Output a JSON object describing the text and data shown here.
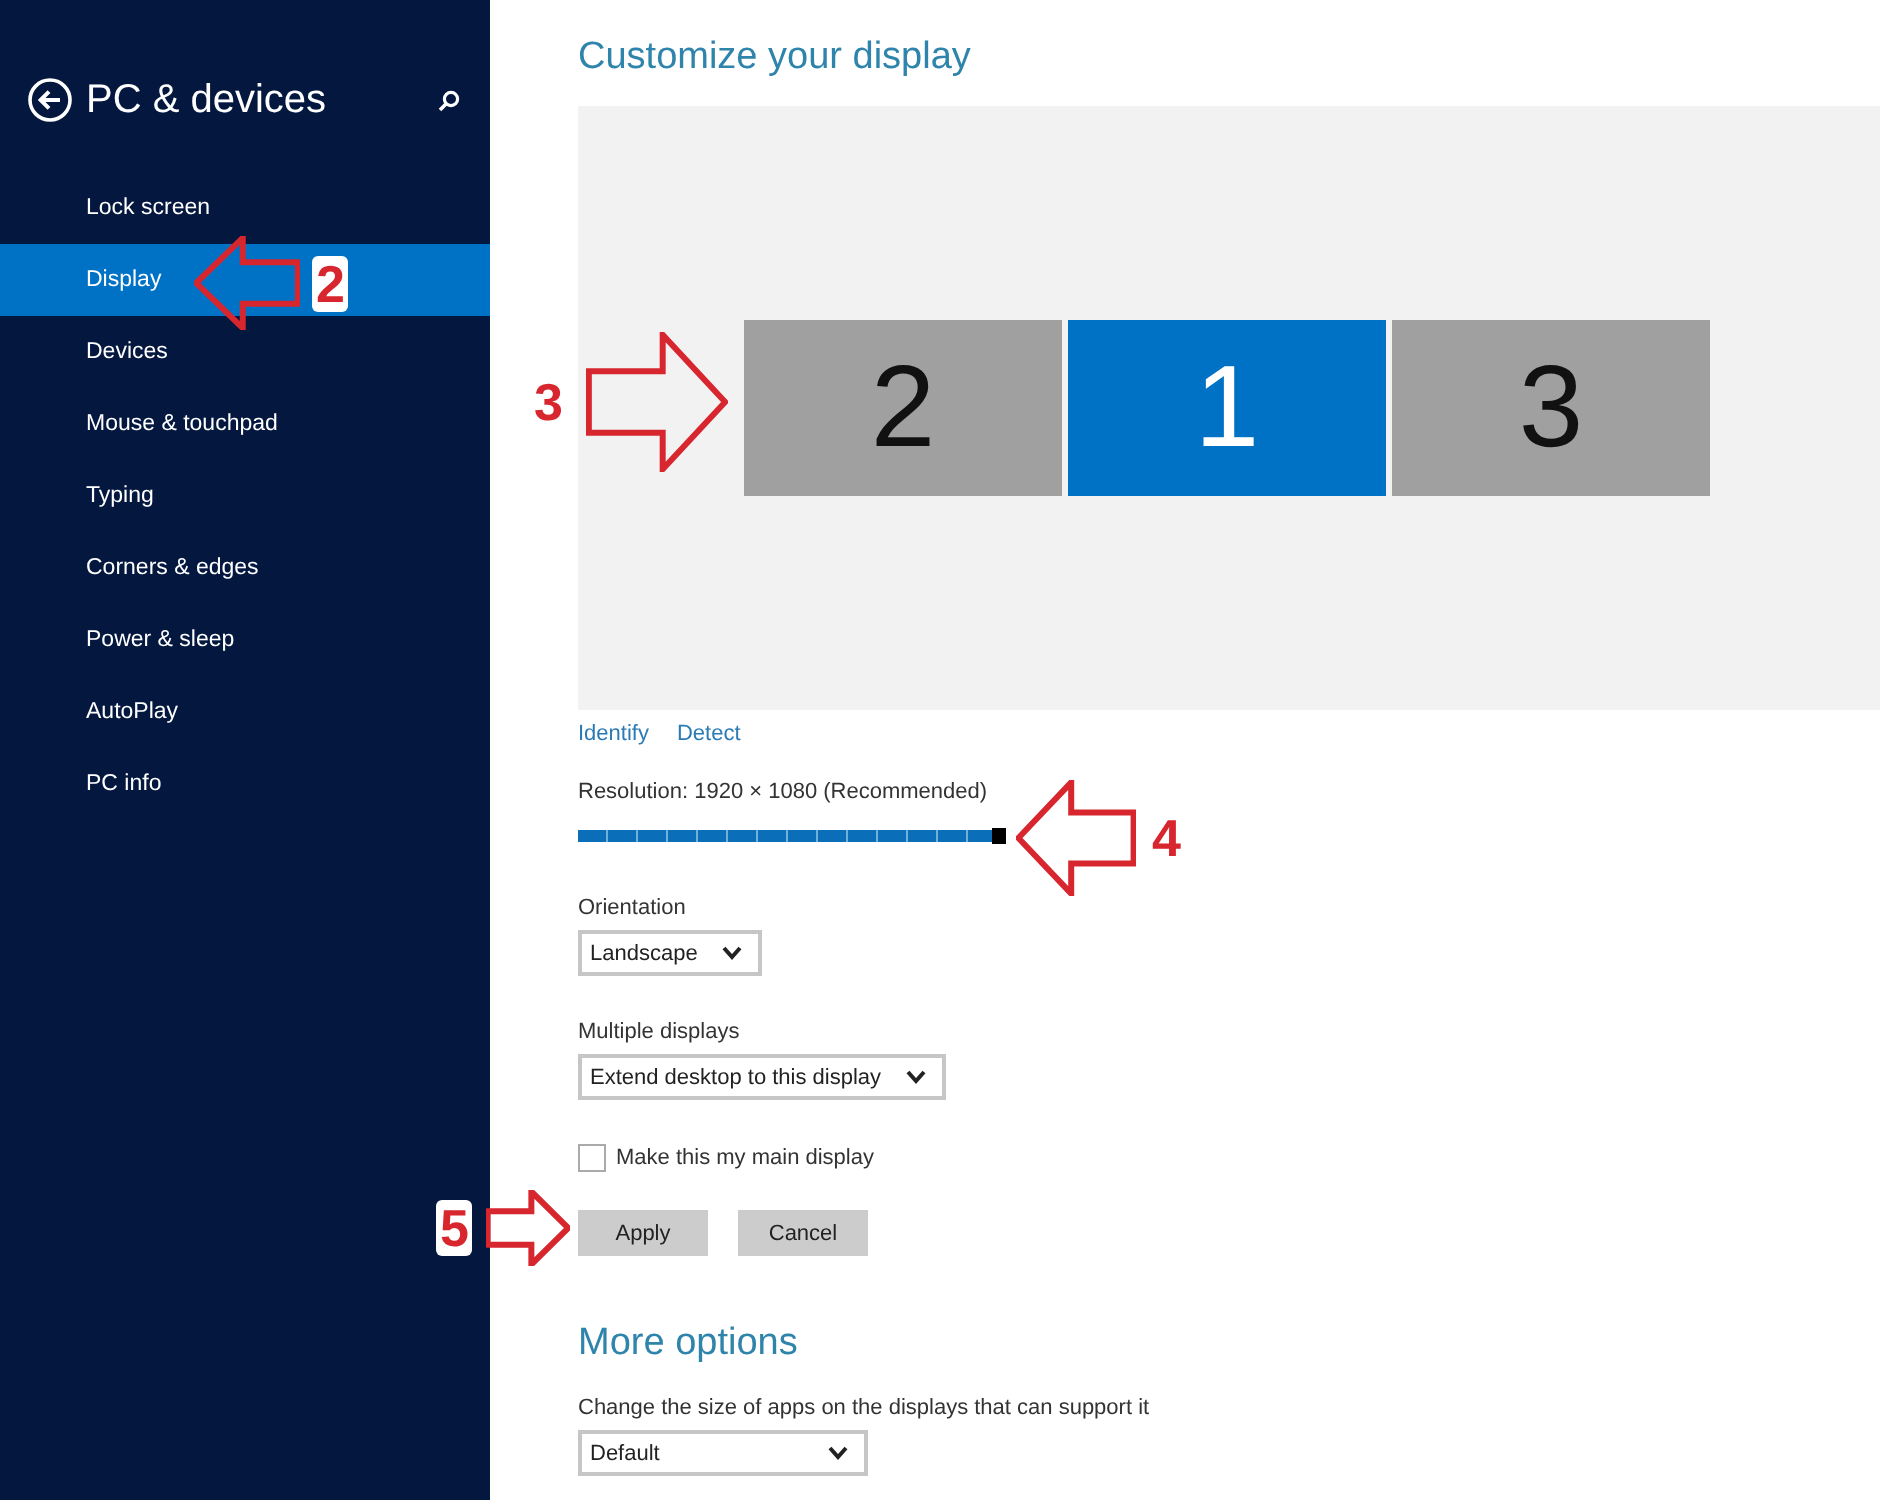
{
  "sidebar": {
    "title": "PC & devices",
    "items": [
      {
        "label": "Lock screen",
        "selected": false
      },
      {
        "label": "Display",
        "selected": true
      },
      {
        "label": "Devices",
        "selected": false
      },
      {
        "label": "Mouse & touchpad",
        "selected": false
      },
      {
        "label": "Typing",
        "selected": false
      },
      {
        "label": "Corners & edges",
        "selected": false
      },
      {
        "label": "Power & sleep",
        "selected": false
      },
      {
        "label": "AutoPlay",
        "selected": false
      },
      {
        "label": "PC info",
        "selected": false
      }
    ]
  },
  "main": {
    "title": "Customize your display",
    "monitors": [
      {
        "number": "2",
        "selected": false
      },
      {
        "number": "1",
        "selected": true
      },
      {
        "number": "3",
        "selected": false
      }
    ],
    "links": [
      "Identify",
      "Detect"
    ],
    "resolution": {
      "label": "Resolution: 1920 × 1080 (Recommended)",
      "level": 1
    },
    "orientation": {
      "label": "Orientation",
      "value": "Landscape"
    },
    "multiple_displays": {
      "label": "Multiple displays",
      "value": "Extend desktop to this display"
    },
    "main_display": {
      "label": "Make this my main display",
      "checked": false
    },
    "buttons": [
      "Apply",
      "Cancel"
    ],
    "more_options": {
      "title": "More options",
      "label": "Change the size of apps on the displays that can support it",
      "value": "Default"
    }
  },
  "annotations": [
    {
      "number": "2",
      "kind": "left"
    },
    {
      "number": "3",
      "kind": "right"
    },
    {
      "number": "4",
      "kind": "left"
    },
    {
      "number": "5",
      "kind": "right"
    }
  ]
}
